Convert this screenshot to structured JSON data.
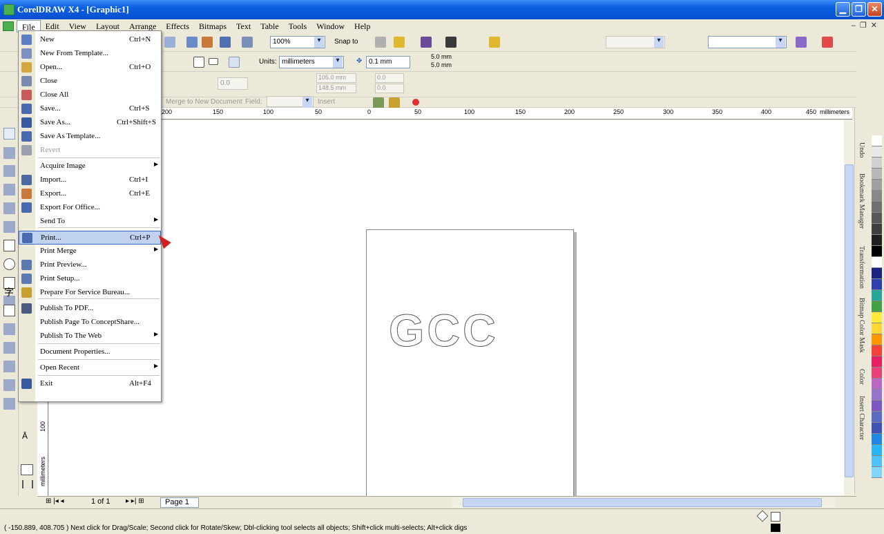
{
  "window": {
    "title": "CorelDRAW X4 - [Graphic1]"
  },
  "menubar": [
    "File",
    "Edit",
    "View",
    "Layout",
    "Arrange",
    "Effects",
    "Bitmaps",
    "Text",
    "Table",
    "Tools",
    "Window",
    "Help"
  ],
  "toolbar": {
    "zoom": "100%",
    "snap_to": "Snap to",
    "units_label": "Units:",
    "units_value": "millimeters",
    "nudge": "0.1 mm",
    "dup_x": "5.0 mm",
    "dup_y": "5.0 mm",
    "pos_x": "105.0 mm",
    "pos_y": "148.5 mm",
    "angle": "0.0",
    "skew_x": "0.0",
    "skew_y": "0.0",
    "merge_label": "Merge to New Document",
    "field_label": "Field:",
    "insert_label": "Insert"
  },
  "ruler": {
    "ticks": [
      "200",
      "150",
      "100",
      "50",
      "0",
      "50",
      "100",
      "150",
      "200",
      "250",
      "300",
      "350",
      "400",
      "450"
    ],
    "units": "millimeters",
    "v_tick": "100",
    "v_units": "millimeters"
  },
  "file_menu": [
    {
      "label": "New",
      "shortcut": "Ctrl+N"
    },
    {
      "label": "New From Template..."
    },
    {
      "label": "Open...",
      "shortcut": "Ctrl+O"
    },
    {
      "label": "Close"
    },
    {
      "label": "Close All"
    },
    {
      "label": "Save...",
      "shortcut": "Ctrl+S"
    },
    {
      "label": "Save As...",
      "shortcut": "Ctrl+Shift+S"
    },
    {
      "label": "Save As Template..."
    },
    {
      "label": "Revert"
    },
    {
      "label": "Acquire Image"
    },
    {
      "label": "Import...",
      "shortcut": "Ctrl+I"
    },
    {
      "label": "Export...",
      "shortcut": "Ctrl+E"
    },
    {
      "label": "Export For Office..."
    },
    {
      "label": "Send To"
    },
    {
      "label": "Print...",
      "shortcut": "Ctrl+P"
    },
    {
      "label": "Print Merge"
    },
    {
      "label": "Print Preview..."
    },
    {
      "label": "Print Setup..."
    },
    {
      "label": "Prepare For Service Bureau..."
    },
    {
      "label": "Publish To PDF..."
    },
    {
      "label": "Publish Page To ConceptShare..."
    },
    {
      "label": "Publish To The Web"
    },
    {
      "label": "Document Properties..."
    },
    {
      "label": "Open Recent"
    },
    {
      "label": "Exit",
      "shortcut": "Alt+F4"
    }
  ],
  "canvas": {
    "text": "GCC"
  },
  "page_nav": {
    "count": "1 of 1",
    "tab": "Page 1"
  },
  "dockers": [
    "Undo",
    "Bookmark Manager",
    "Transformation",
    "Bitmap Color Mask",
    "Color",
    "Insert Character"
  ],
  "palette": [
    "#ffffff",
    "#e8e8e8",
    "#d0d0d0",
    "#b8b8b8",
    "#a0a0a0",
    "#888888",
    "#707070",
    "#585858",
    "#404040",
    "#202020",
    "#000000",
    "#ffffff",
    "#1a237e",
    "#2e3fae",
    "#26a69a",
    "#43a047",
    "#ffeb3b",
    "#fdd835",
    "#ff9800",
    "#f44336",
    "#e91e63",
    "#ec407a",
    "#ba68c8",
    "#9575cd",
    "#7e57c2",
    "#5c6bc0",
    "#3f51b5",
    "#1e88e5",
    "#29b6f6",
    "#4fc3f7",
    "#81d4fa"
  ],
  "status": {
    "text": "( -150.889, 408.705 )  Next click for Drag/Scale; Second click for Rotate/Skew; Dbl-clicking tool selects all objects; Shift+click multi-selects; Alt+click digs"
  },
  "colors": {
    "accent": "#0a5ee0",
    "highlight": "#c1d2ee",
    "cursor": "#d21f1f"
  }
}
